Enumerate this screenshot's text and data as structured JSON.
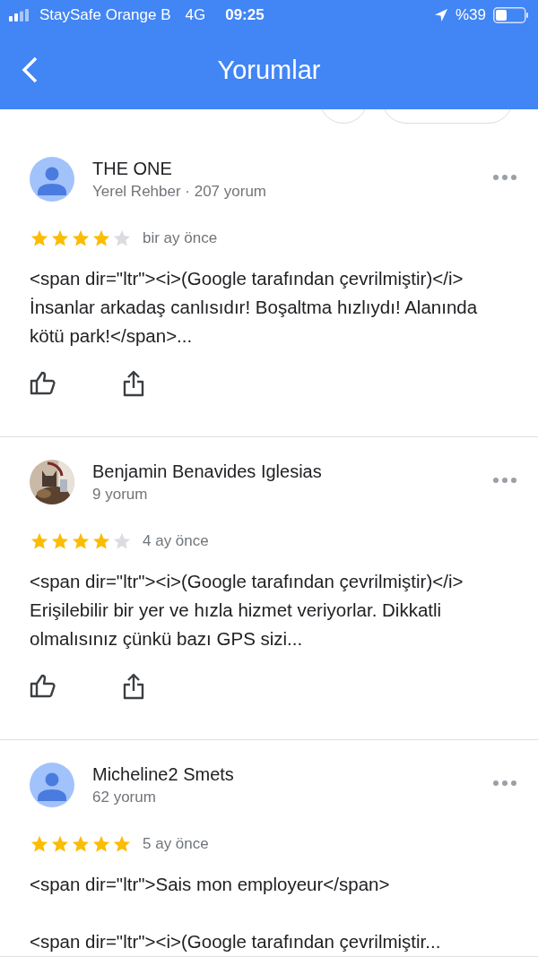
{
  "status_bar": {
    "carrier": "StaySafe Orange B",
    "network": "4G",
    "time": "09:25",
    "battery": "%39"
  },
  "header": {
    "title": "Yorumlar"
  },
  "reviews": [
    {
      "name": "THE ONE",
      "avatar": {
        "kind": "default"
      },
      "count": "Yerel Rehber · 207 yorum",
      "stars": 4,
      "time": "bir ay önce",
      "text": "<span dir=\"ltr\"><i>(Google tarafından çevrilmiştir)</i> İnsanlar arkadaş canlısıdır! Boşaltma hızlıydı! Alanında kötü park!</span>...",
      "actions": true
    },
    {
      "name": "Benjamin Benavides Iglesias",
      "count": "9 yorum",
      "stars": 4,
      "time": "4 ay önce",
      "text": "<span dir=\"ltr\"><i>(Google tarafından çevrilmiştir)</i> Erişilebilir bir yer ve hızla hizmet veriyorlar. Dikkatli olmalısınız çünkü bazı GPS sizi...",
      "actions": true
    },
    {
      "name": "Micheline2 Smets",
      "avatar": {
        "kind": "default"
      },
      "count": "62 yorum",
      "stars": 5,
      "time": "5 ay önce",
      "text": "<span dir=\"ltr\">Sais mon employeur</span>\n\n<span dir=\"ltr\"><i>(Google tarafından çevrilmiştir...",
      "actions": false
    }
  ]
}
